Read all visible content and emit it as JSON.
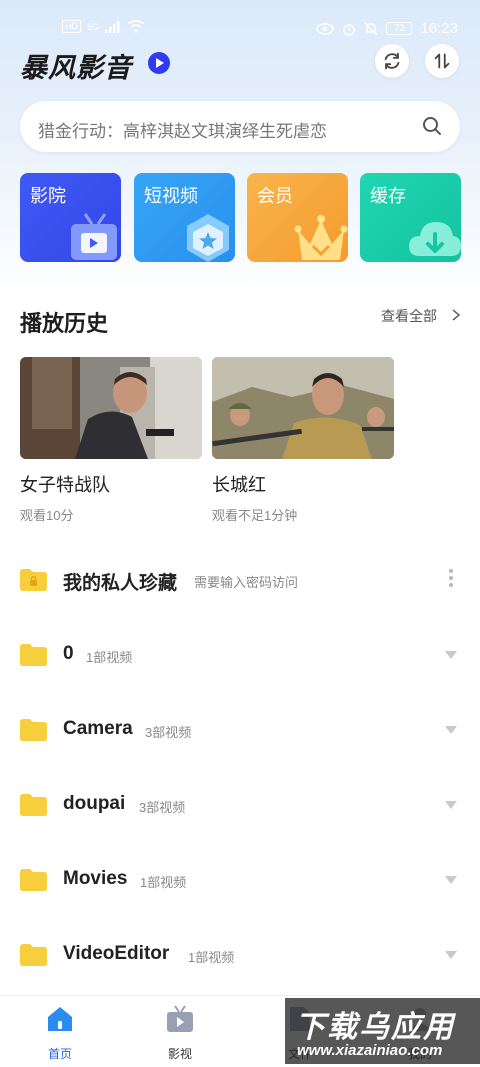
{
  "status_bar": {
    "chips": [
      "HD",
      "5G"
    ],
    "battery": "72",
    "time": "16:23"
  },
  "header": {
    "app_title": "暴风影音",
    "icons": [
      "refresh-icon",
      "sort-icon"
    ]
  },
  "search": {
    "placeholder": "猎金行动：高梓淇赵文琪演绎生死虐恋"
  },
  "quick_entries": [
    {
      "label": "影院",
      "color": "#3d55f2",
      "icon": "tv-icon"
    },
    {
      "label": "短视频",
      "color": "#2f9ef2",
      "icon": "hexagon-star-icon"
    },
    {
      "label": "会员",
      "color": "#f7a83a",
      "icon": "crown-icon"
    },
    {
      "label": "缓存",
      "color": "#1fcfae",
      "icon": "cloud-download-icon"
    }
  ],
  "history": {
    "title": "播放历史",
    "see_all": "查看全部",
    "items": [
      {
        "title": "女子特战队",
        "progress": "观看10分"
      },
      {
        "title": "长城红",
        "progress": "观看不足1分钟"
      }
    ]
  },
  "folders": [
    {
      "name": "我的私人珍藏",
      "hint": "需要输入密码访问",
      "locked": true
    },
    {
      "name": "0",
      "count": "1部视频"
    },
    {
      "name": "Camera",
      "count": "3部视频"
    },
    {
      "name": "doupai",
      "count": "3部视频"
    },
    {
      "name": "Movies",
      "count": "1部视频"
    },
    {
      "name": "VideoEditor",
      "count": "1部视频"
    }
  ],
  "bottom_nav": [
    {
      "label": "首页",
      "active": true
    },
    {
      "label": "影视",
      "active": false
    },
    {
      "label": "文件",
      "active": false
    },
    {
      "label": "我的",
      "active": false
    }
  ],
  "watermark": {
    "main": "下载乌应用",
    "sub": "www.xiazainiao.com"
  },
  "colors": {
    "accent": "#2a62e6",
    "folder": "#f7cf3c"
  }
}
